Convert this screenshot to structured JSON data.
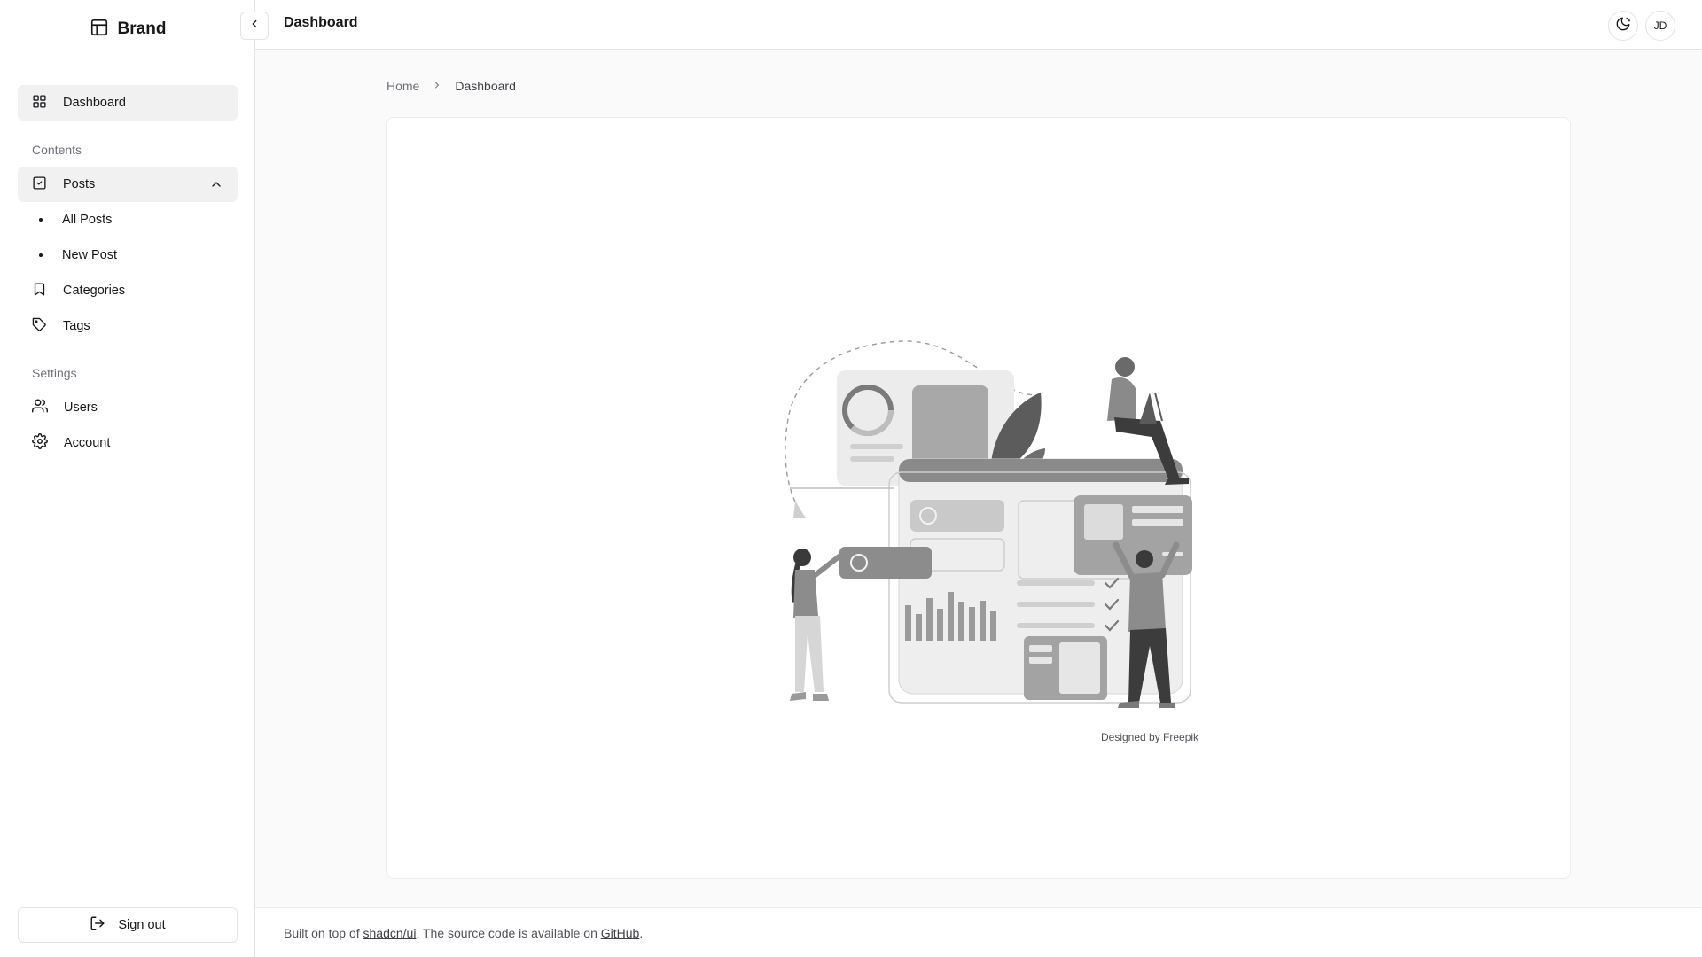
{
  "brand": {
    "name": "Brand"
  },
  "sidebar": {
    "dashboard_label": "Dashboard",
    "sections": {
      "contents": "Contents",
      "settings": "Settings"
    },
    "posts": {
      "label": "Posts",
      "children": [
        "All Posts",
        "New Post"
      ]
    },
    "categories_label": "Categories",
    "tags_label": "Tags",
    "users_label": "Users",
    "account_label": "Account",
    "signout_label": "Sign out"
  },
  "header": {
    "title": "Dashboard",
    "avatar_initials": "JD"
  },
  "breadcrumb": {
    "home": "Home",
    "current": "Dashboard"
  },
  "main": {
    "illustration_credit": "Designed by Freepik"
  },
  "footer": {
    "prefix": "Built on top of ",
    "link1": "shadcn/ui",
    "middle": ". The source code is available on ",
    "link2": "GitHub",
    "suffix": "."
  }
}
